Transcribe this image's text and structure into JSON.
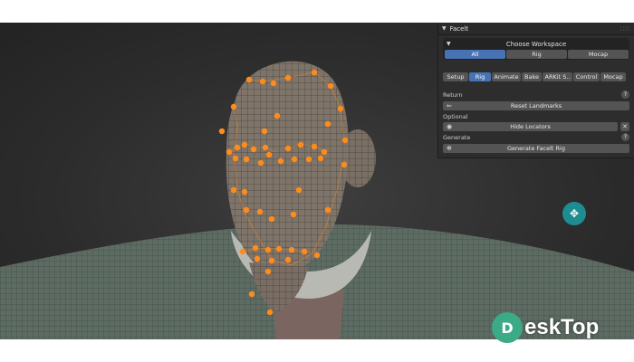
{
  "panel": {
    "title": "Facelt",
    "choose_workspace": "Choose Workspace",
    "workspace_tabs": [
      "All",
      "Rig",
      "Mocap"
    ],
    "active_workspace": "All",
    "mode_tabs": [
      "Setup",
      "Rig",
      "Animate",
      "Bake",
      "ARKit S..",
      "Control",
      "Mocap"
    ],
    "active_mode": "Rig",
    "return_label": "Return",
    "reset_landmarks": "Reset Landmarks",
    "optional_label": "Optional",
    "hide_locators": "Hide Locators",
    "generate_label": "Generate",
    "generate_rig": "Generate Facelt Rig",
    "help_glyph": "?"
  },
  "watermark": {
    "logo_letter": "D",
    "text": "eskTop"
  },
  "colors": {
    "accent": "#4772b3",
    "landmark": "#ff8c1a",
    "nav_circle": "#1d8d91"
  },
  "icons": {
    "collapse": "triangle-down-icon",
    "back": "arrow-left-icon",
    "eye": "eye-icon",
    "close": "close-icon",
    "figure": "running-figure-icon",
    "navigate": "move-cross-icon"
  }
}
